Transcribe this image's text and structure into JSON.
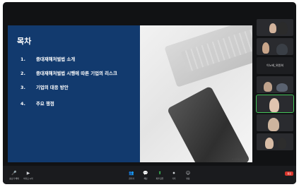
{
  "slide": {
    "title": "목차",
    "items": [
      {
        "num": "1.",
        "text": "중대재해처벌법 소개"
      },
      {
        "num": "2.",
        "text": "중대재해처벌법 시행에 따른 기업의 리스크"
      },
      {
        "num": "3.",
        "text": "기업의 대응 방안"
      },
      {
        "num": "4.",
        "text": "주요 쟁점"
      }
    ]
  },
  "participants": [
    {
      "kind": "video",
      "label": ""
    },
    {
      "kind": "video",
      "label": ""
    },
    {
      "kind": "name",
      "label": "이노베_위원회"
    },
    {
      "kind": "video",
      "label": ""
    },
    {
      "kind": "video",
      "label": "",
      "active": true
    },
    {
      "kind": "video",
      "label": ""
    },
    {
      "kind": "video",
      "label": ""
    }
  ],
  "toolbar": {
    "left": [
      {
        "icon": "mic-icon",
        "glyph": "🎤",
        "label": "음소거 해제"
      },
      {
        "icon": "video-icon",
        "glyph": "▶",
        "label": "비디오 시작"
      }
    ],
    "center": [
      {
        "icon": "participants-icon",
        "glyph": "👥",
        "label": "참가자"
      },
      {
        "icon": "chat-icon",
        "glyph": "💬",
        "label": "채팅"
      },
      {
        "icon": "share-screen-icon",
        "glyph": "⬆",
        "label": "화면 공유",
        "accent": true
      },
      {
        "icon": "record-icon",
        "glyph": "⏺",
        "label": "기록"
      },
      {
        "icon": "reactions-icon",
        "glyph": "☺",
        "label": "반응"
      }
    ],
    "end_label": "종료"
  },
  "colors": {
    "slide_blue": "#123a6e",
    "accent_green": "#3ec85a",
    "end_red": "#d9342b"
  }
}
